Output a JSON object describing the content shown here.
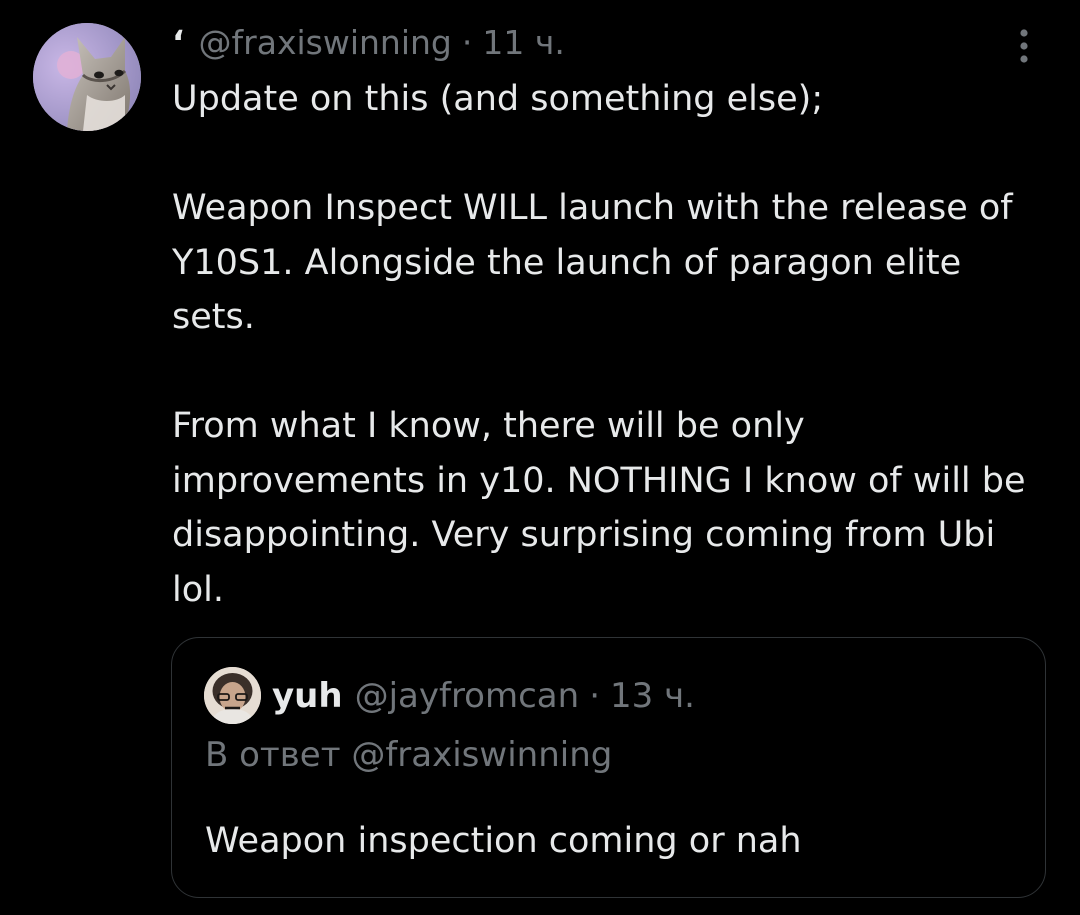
{
  "tweet": {
    "name": "‘",
    "handle": "@fraxiswinning",
    "separator": "·",
    "time": "11 ч.",
    "paragraphs": [
      "Update on this (and something else);",
      "Weapon Inspect WILL launch with the release of Y10S1. Alongside the launch of paragon elite sets.",
      "From what I know, there will be only improvements in y10. NOTHING I know of will be disappointing. Very surprising coming from Ubi lol."
    ],
    "more_icon": "more-vertical-icon",
    "avatar_icon": "cat-avatar"
  },
  "quote": {
    "name": "yuh",
    "handle": "@jayfromcan",
    "separator": "·",
    "time": "13 ч.",
    "reply_prefix": "В ответ",
    "reply_to": "@fraxiswinning",
    "text": "Weapon inspection coming or nah",
    "avatar_icon": "person-avatar"
  },
  "colors": {
    "background": "#000000",
    "primary_text": "#e7e9ea",
    "secondary_text": "#71767b",
    "border": "#2f3336"
  }
}
